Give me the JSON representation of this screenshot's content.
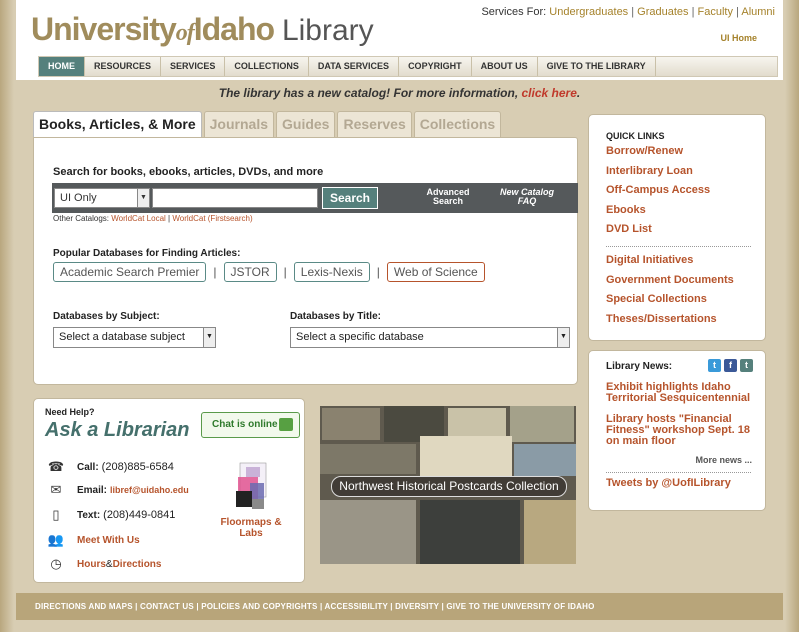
{
  "header": {
    "logo": {
      "university": "University",
      "of": "of",
      "idaho": "Idaho",
      "library": "Library"
    },
    "services_for_label": "Services For:",
    "services_links": [
      "Undergraduates",
      "Graduates",
      "Faculty",
      "Alumni"
    ],
    "ui_home": "UI Home"
  },
  "nav": {
    "items": [
      "HOME",
      "RESOURCES",
      "SERVICES",
      "COLLECTIONS",
      "DATA SERVICES",
      "COPYRIGHT",
      "ABOUT US",
      "GIVE TO THE LIBRARY"
    ]
  },
  "announcement": {
    "text": "The library has a new catalog! For more information, ",
    "link": "click here",
    "end": "."
  },
  "search": {
    "tabs": [
      "Books, Articles, & More",
      "Journals",
      "Guides",
      "Reserves",
      "Collections"
    ],
    "heading": "Search for books, ebooks, articles, DVDs, and more",
    "scope_value": "UI Only",
    "query_value": "",
    "button": "Search",
    "advanced": "Advanced Search",
    "new_catalog_faq": "New Catalog FAQ",
    "other_catalogs_label": "Other Catalogs:",
    "other_catalogs": [
      "WorldCat Local",
      "WorldCat (Firstsearch)"
    ],
    "popular_label": "Popular Databases for Finding Articles:",
    "popular_databases": [
      "Academic Search Premier",
      "JSTOR",
      "Lexis-Nexis",
      "Web of Science"
    ],
    "by_subject_label": "Databases by Subject:",
    "by_subject_value": "Select a database subject",
    "by_title_label": "Databases by Title:",
    "by_title_value": "Select a specific database"
  },
  "quick_links": {
    "title": "QUICK LINKS",
    "group1": [
      "Borrow/Renew",
      "Interlibrary Loan",
      "Off-Campus Access",
      "Ebooks",
      "DVD List"
    ],
    "group2": [
      "Digital Initiatives",
      "Government Documents",
      "Special Collections",
      "Theses/Dissertations"
    ]
  },
  "news": {
    "title": "Library News:",
    "items": [
      "Exhibit highlights Idaho Territorial Sesquicentennial",
      "Library hosts \"Financial Fitness\" workshop Sept. 18 on main floor"
    ],
    "more": "More news ...",
    "tweets": "Tweets by @UofILibrary"
  },
  "help": {
    "need_help": "Need Help?",
    "ask": "Ask a Librarian",
    "chat": "Chat is online",
    "call_label": "Call:",
    "call_value": "(208)885-6584",
    "email_label": "Email:",
    "email_value": "libref@uidaho.edu",
    "text_label": "Text:",
    "text_value": "(208)449-0841",
    "meet": "Meet With Us",
    "hours_a": "Hours",
    "hours_amp": " & ",
    "hours_b": "Directions",
    "floormaps": "Floormaps & Labs"
  },
  "postcards": {
    "caption": "Northwest Historical Postcards Collection"
  },
  "footer": {
    "links": [
      "DIRECTIONS AND MAPS",
      "CONTACT US",
      "POLICIES AND COPYRIGHTS",
      "ACCESSIBILITY",
      "DIVERSITY",
      "GIVE TO THE UNIVERSITY OF IDAHO"
    ]
  },
  "colors": {
    "accent_teal": "#55807c",
    "link_rust": "#b6542c",
    "gold": "#a5822b",
    "footer": "#b8a57a"
  }
}
